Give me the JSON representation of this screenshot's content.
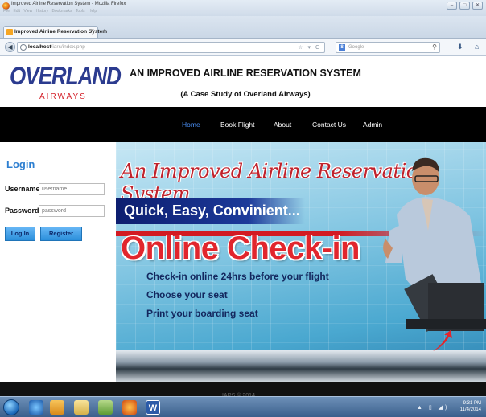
{
  "browser": {
    "window_title": "Improved Airline Reservation System - Mozilla Firefox",
    "menus": "File  Edit  View  History  Bookmarks  Tools  Help",
    "tab_label": "Improved Airline Reservation System",
    "url_host": "localhost",
    "url_path": "/iars/index.php",
    "search_placeholder": "Google"
  },
  "header": {
    "logo_main": "OVERLAND",
    "logo_sub": "AIRWAYS",
    "title": "AN IMPROVED AIRLINE RESERVATION SYSTEM",
    "subtitle": "(A Case Study of Overland Airways)"
  },
  "nav": {
    "items": [
      {
        "label": "Home",
        "active": true
      },
      {
        "label": "Book Flight"
      },
      {
        "label": "About"
      },
      {
        "label": "Contact Us"
      },
      {
        "label": "Admin"
      }
    ]
  },
  "login": {
    "title": "Login",
    "username_label": "Username",
    "username_placeholder": "username",
    "password_label": "Password",
    "password_placeholder": "password",
    "login_button": "Log In",
    "register_button": "Register"
  },
  "banner": {
    "script_title": "An Improved Airline Reservation System",
    "tagline": "Quick, Easy, Convinient...",
    "headline": "Online Check-in",
    "lines": [
      "Check-in online 24hrs before your flight",
      "Choose your seat",
      "Print your boarding seat"
    ]
  },
  "footer": {
    "text": "IARS © 2014"
  },
  "taskbar": {
    "time": "9:31 PM",
    "date": "11/4/2014"
  }
}
